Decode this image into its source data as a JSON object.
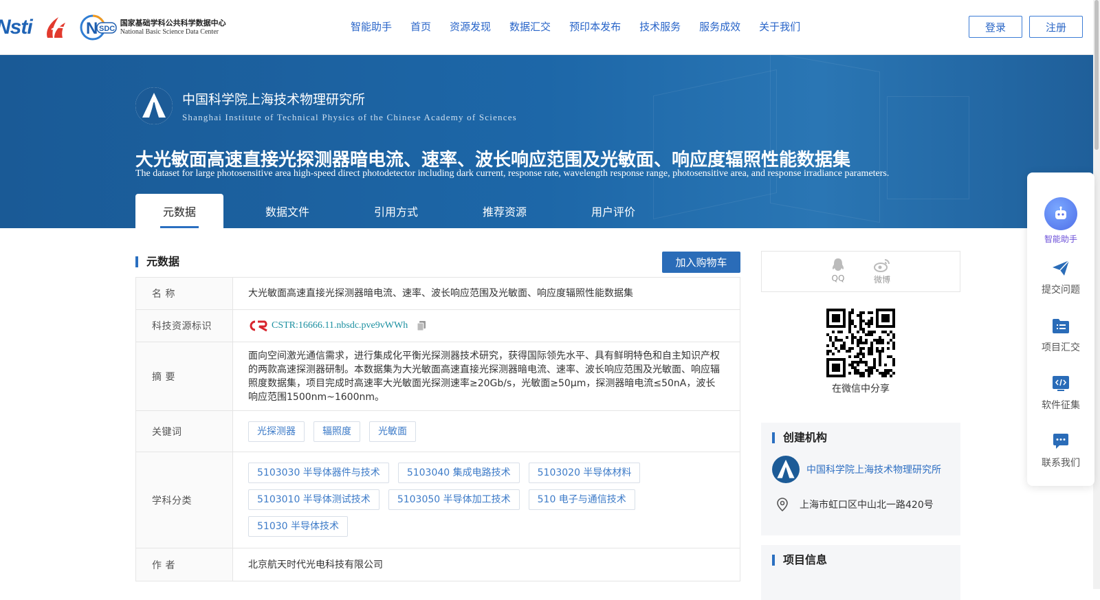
{
  "header": {
    "logos": {
      "nstl": "Nsti",
      "nsdc_mark": "NSDC",
      "nsdc_cn": "国家基础学科公共科学数据中心",
      "nsdc_en": "National Basic Science Data Center"
    },
    "nav": [
      "智能助手",
      "首页",
      "资源发现",
      "数据汇交",
      "预印本发布",
      "技术服务",
      "服务成效",
      "关于我们"
    ],
    "login": "登录",
    "register": "注册"
  },
  "banner": {
    "institution_cn": "中国科学院上海技术物理研究所",
    "institution_en": "Shanghai Institute of Technical Physics of the Chinese Academy of Sciences",
    "title": "大光敏面高速直接光探测器暗电流、速率、波长响应范围及光敏面、响应度辐照性能数据集",
    "subtitle": "The dataset for large photosensitive area high-speed direct photodetector including dark current, response rate, wavelength response range, photosensitive area, and response irradiance parameters.",
    "tabs": [
      "元数据",
      "数据文件",
      "引用方式",
      "推荐资源",
      "用户评价"
    ],
    "active_tab": "元数据"
  },
  "metadata": {
    "section_title": "元数据",
    "cart_button": "加入购物车",
    "name_label": "名 称",
    "name_value": "大光敏面高速直接光探测器暗电流、速率、波长响应范围及光敏面、响应度辐照性能数据集",
    "cstr_label": "科技资源标识",
    "cstr_value": "CSTR:16666.11.nbsdc.pve9vWWh",
    "abstract_label": "摘 要",
    "abstract_value": "面向空间激光通信需求，进行集成化平衡光探测器技术研究，获得国际领先水平、具有鲜明特色和自主知识产权的两款高速探测器研制。本数据集为大光敏面高速直接光探测器暗电流、速率、波长响应范围及光敏面、响应辐照度数据集，项目完成时高速率大光敏面光探测速率≥20Gb/s，光敏面≥50μm，探测器暗电流≤50nA，波长响应范围1500nm~1600nm。",
    "keywords_label": "关键词",
    "keywords": [
      "光探测器",
      "辐照度",
      "光敏面"
    ],
    "subject_label": "学科分类",
    "subjects": [
      [
        "5103030 半导体器件与技术",
        "5103040 集成电路技术",
        "5103020 半导体材料"
      ],
      [
        "5103010 半导体测试技术",
        "5103050 半导体加工技术",
        "510 电子与通信技术"
      ],
      [
        "51030 半导体技术"
      ]
    ],
    "author_label": "作 者",
    "author_value": "北京航天时代光电科技有限公司"
  },
  "sidebar": {
    "share_qq": "QQ",
    "share_weibo": "微博",
    "qr_caption": "在微信中分享",
    "creator_title": "创建机构",
    "creator_name": "中国科学院上海技术物理研究所",
    "creator_address": "上海市虹口区中山北一路420号",
    "project_title": "项目信息"
  },
  "float_panel": {
    "items": [
      "智能助手",
      "提交问题",
      "项目汇交",
      "软件征集",
      "联系我们"
    ]
  },
  "colors": {
    "brand_blue": "#2a6cb8",
    "banner_blue": "#1d67a8",
    "link_teal": "#1a8fa0"
  }
}
